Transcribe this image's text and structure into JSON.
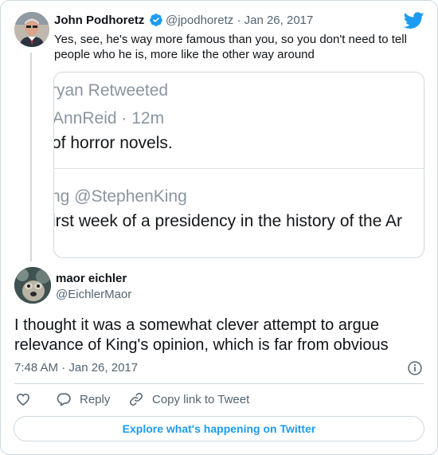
{
  "parent_tweet": {
    "author_name": "John Podhoretz",
    "author_handle": "@jpodhoretz",
    "date": "Jan 26, 2017",
    "handle_date": "@jpodhoretz · Jan 26, 2017",
    "text": "Yes, see, he's way more famous than you, so you don't need to tell people who he is, more like the other way around",
    "quoted_image_lines": [
      "ryan Retweeted",
      "AnnReid · 12m",
      "of horror novels.",
      "ng @StephenKing",
      "irst week of a presidency in the history of the Ar"
    ]
  },
  "reply_tweet": {
    "author_name": "maor eichler",
    "author_handle": "@EichlerMaor",
    "text": "I thought it was a somewhat clever attempt to argue relevance of King's opinion, which is far from obvious",
    "timestamp": "7:48 AM · Jan 26, 2017"
  },
  "actions": {
    "like_icon": "heart-icon",
    "reply_label": "Reply",
    "copy_link_label": "Copy link to Tweet"
  },
  "footer": {
    "explore_label": "Explore what's happening on Twitter"
  },
  "icons": {
    "verified": "verified-badge-icon",
    "brand": "twitter-bird-icon",
    "info": "info-icon",
    "reply": "speech-bubble-icon",
    "copy_link": "link-icon"
  },
  "colors": {
    "accent": "#1d9bf0",
    "text_primary": "#0f1419",
    "text_secondary": "#536471",
    "border": "#cfd9de"
  }
}
